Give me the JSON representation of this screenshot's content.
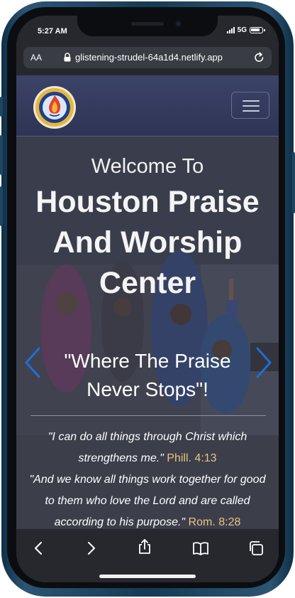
{
  "status_bar": {
    "time": "5:27 AM",
    "network": "5G"
  },
  "browser": {
    "text_size_label": "AA",
    "url": "glistening-strudel-64a1d4.netlify.app"
  },
  "site": {
    "logo": {
      "icon": "church-flame-logo-icon",
      "ring_text": "HOUSTON PRAISE AND WORSHIP CENTER"
    },
    "menu_icon": "hamburger-menu-icon"
  },
  "hero": {
    "welcome": "Welcome To",
    "title": "Houston Praise And Worship Center",
    "tagline": "\"Where The Praise Never Stops\"!",
    "verse1_text": "\"I can do all things through Christ which strengthens me.\"",
    "verse1_ref": "Phill. 4:13",
    "verse2_text": "\"And we know all things work together for good to them who love the Lord and are called according to his purpose.\"",
    "verse2_ref": "Rom. 8:28",
    "arrow_color": "#1f6fd6",
    "reference_color": "#e8c583"
  },
  "toolbar": {
    "icons": [
      "back-icon",
      "forward-icon",
      "share-icon",
      "bookmarks-icon",
      "tabs-icon"
    ]
  }
}
